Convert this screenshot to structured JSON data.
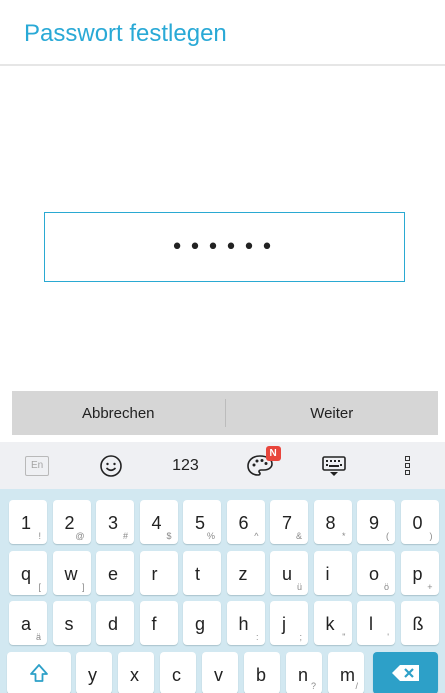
{
  "dialog": {
    "title": "Passwort festlegen"
  },
  "password": {
    "masked_value": "••••••"
  },
  "buttons": {
    "cancel": "Abbrechen",
    "next": "Weiter"
  },
  "suggestion_bar": {
    "language": "En",
    "numbers": "123",
    "notification_badge": "N"
  },
  "keyboard": {
    "row1": [
      {
        "main": "1",
        "sub": "!"
      },
      {
        "main": "2",
        "sub": "@"
      },
      {
        "main": "3",
        "sub": "#"
      },
      {
        "main": "4",
        "sub": "$"
      },
      {
        "main": "5",
        "sub": "%"
      },
      {
        "main": "6",
        "sub": "^"
      },
      {
        "main": "7",
        "sub": "&"
      },
      {
        "main": "8",
        "sub": "*"
      },
      {
        "main": "9",
        "sub": "("
      },
      {
        "main": "0",
        "sub": ")"
      }
    ],
    "row2": [
      {
        "main": "q",
        "sub": "["
      },
      {
        "main": "w",
        "sub": "]"
      },
      {
        "main": "e",
        "sub": ""
      },
      {
        "main": "r",
        "sub": ""
      },
      {
        "main": "t",
        "sub": ""
      },
      {
        "main": "z",
        "sub": ""
      },
      {
        "main": "u",
        "sub": "ü"
      },
      {
        "main": "i",
        "sub": ""
      },
      {
        "main": "o",
        "sub": "ö"
      },
      {
        "main": "p",
        "sub": "+"
      }
    ],
    "row3": [
      {
        "main": "a",
        "sub": "ä"
      },
      {
        "main": "s",
        "sub": ""
      },
      {
        "main": "d",
        "sub": ""
      },
      {
        "main": "f",
        "sub": ""
      },
      {
        "main": "g",
        "sub": ""
      },
      {
        "main": "h",
        "sub": ":"
      },
      {
        "main": "j",
        "sub": ";"
      },
      {
        "main": "k",
        "sub": "\""
      },
      {
        "main": "l",
        "sub": "'"
      },
      {
        "main": "ß",
        "sub": ""
      }
    ],
    "row4": [
      {
        "main": "y",
        "sub": ""
      },
      {
        "main": "x",
        "sub": ""
      },
      {
        "main": "c",
        "sub": ""
      },
      {
        "main": "v",
        "sub": ""
      },
      {
        "main": "b",
        "sub": ""
      },
      {
        "main": "n",
        "sub": "?"
      },
      {
        "main": "m",
        "sub": "/"
      }
    ]
  },
  "icons": {
    "emoji": "emoji-icon",
    "palette": "palette-icon",
    "keyboard_hide": "keyboard-hide-icon",
    "more": "more-options-icon",
    "shift": "shift-icon",
    "backspace": "backspace-icon"
  },
  "colors": {
    "accent": "#29a9d6",
    "keyboard_bg": "#d2e8f1",
    "backspace_key": "#2da0c8",
    "badge": "#e8453c"
  }
}
